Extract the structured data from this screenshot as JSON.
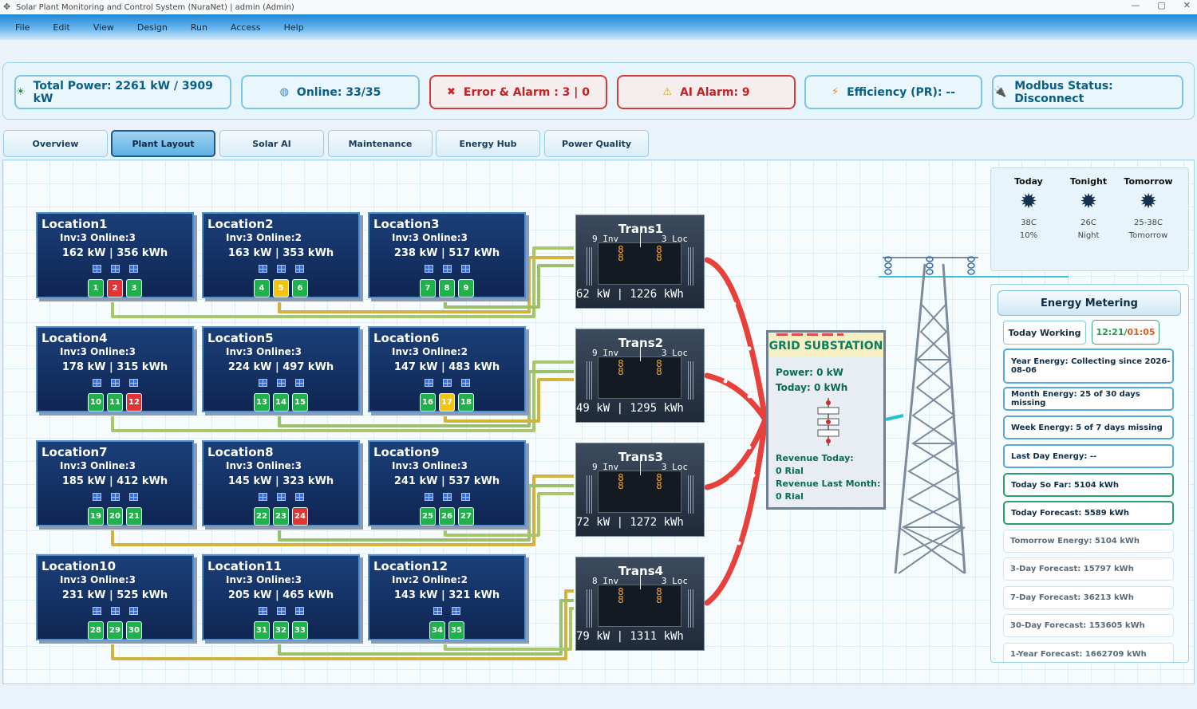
{
  "window": {
    "title": "Solar Plant Monitoring and Control System (NuraNet) | admin (Admin)",
    "minimize": "—",
    "maximize": "▢",
    "close": "✕"
  },
  "menu": [
    "File",
    "Edit",
    "View",
    "Design",
    "Run",
    "Access",
    "Help"
  ],
  "status": {
    "total_power": "Total Power: 2261 kW / 3909 kW",
    "online": "Online: 33/35",
    "error_alarm": "Error & Alarm : 3 | 0",
    "ai_alarm": "AI Alarm: 9",
    "efficiency": "Efficiency (PR): --",
    "modbus": "Modbus Status: Disconnect"
  },
  "tabs": [
    "Overview",
    "Plant Layout",
    "Solar AI",
    "Maintenance",
    "Energy Hub",
    "Power Quality"
  ],
  "active_tab": "Plant Layout",
  "locations": [
    {
      "name": "Location1",
      "inv": "Inv:3  Online:3",
      "power": "162 kW  |  356 kWh",
      "inverters": [
        {
          "n": "1",
          "s": "ok"
        },
        {
          "n": "2",
          "s": "err"
        },
        {
          "n": "3",
          "s": "ok"
        }
      ]
    },
    {
      "name": "Location2",
      "inv": "Inv:3  Online:2",
      "power": "163 kW  |  353 kWh",
      "inverters": [
        {
          "n": "4",
          "s": "ok"
        },
        {
          "n": "5",
          "s": "warn"
        },
        {
          "n": "6",
          "s": "ok"
        }
      ]
    },
    {
      "name": "Location3",
      "inv": "Inv:3  Online:3",
      "power": "238 kW  |  517 kWh",
      "inverters": [
        {
          "n": "7",
          "s": "ok"
        },
        {
          "n": "8",
          "s": "ok"
        },
        {
          "n": "9",
          "s": "ok"
        }
      ]
    },
    {
      "name": "Location4",
      "inv": "Inv:3  Online:3",
      "power": "178 kW  |  315 kWh",
      "inverters": [
        {
          "n": "10",
          "s": "ok"
        },
        {
          "n": "11",
          "s": "ok"
        },
        {
          "n": "12",
          "s": "err"
        }
      ]
    },
    {
      "name": "Location5",
      "inv": "Inv:3  Online:3",
      "power": "224 kW  |  497 kWh",
      "inverters": [
        {
          "n": "13",
          "s": "ok"
        },
        {
          "n": "14",
          "s": "ok"
        },
        {
          "n": "15",
          "s": "ok"
        }
      ]
    },
    {
      "name": "Location6",
      "inv": "Inv:3  Online:2",
      "power": "147 kW  |  483 kWh",
      "inverters": [
        {
          "n": "16",
          "s": "ok"
        },
        {
          "n": "17",
          "s": "warn"
        },
        {
          "n": "18",
          "s": "ok"
        }
      ]
    },
    {
      "name": "Location7",
      "inv": "Inv:3  Online:3",
      "power": "185 kW  |  412 kWh",
      "inverters": [
        {
          "n": "19",
          "s": "ok"
        },
        {
          "n": "20",
          "s": "ok"
        },
        {
          "n": "21",
          "s": "ok"
        }
      ]
    },
    {
      "name": "Location8",
      "inv": "Inv:3  Online:3",
      "power": "145 kW  |  323 kWh",
      "inverters": [
        {
          "n": "22",
          "s": "ok"
        },
        {
          "n": "23",
          "s": "ok"
        },
        {
          "n": "24",
          "s": "err"
        }
      ]
    },
    {
      "name": "Location9",
      "inv": "Inv:3  Online:3",
      "power": "241 kW  |  537 kWh",
      "inverters": [
        {
          "n": "25",
          "s": "ok"
        },
        {
          "n": "26",
          "s": "ok"
        },
        {
          "n": "27",
          "s": "ok"
        }
      ]
    },
    {
      "name": "Location10",
      "inv": "Inv:3  Online:3",
      "power": "231 kW  |  525 kWh",
      "inverters": [
        {
          "n": "28",
          "s": "ok"
        },
        {
          "n": "29",
          "s": "ok"
        },
        {
          "n": "30",
          "s": "ok"
        }
      ]
    },
    {
      "name": "Location11",
      "inv": "Inv:3  Online:3",
      "power": "205 kW  |  465 kWh",
      "inverters": [
        {
          "n": "31",
          "s": "ok"
        },
        {
          "n": "32",
          "s": "ok"
        },
        {
          "n": "33",
          "s": "ok"
        }
      ]
    },
    {
      "name": "Location12",
      "inv": "Inv:2  Online:2",
      "power": "143 kW  |  321 kWh",
      "inverters": [
        {
          "n": "34",
          "s": "ok"
        },
        {
          "n": "35",
          "s": "ok"
        }
      ]
    }
  ],
  "transformers": [
    {
      "name": "Trans1",
      "inv": "9 Inv",
      "loc": "3 Loc",
      "bottom": "62 kW  |  1226 kWh"
    },
    {
      "name": "Trans2",
      "inv": "9 Inv",
      "loc": "3 Loc",
      "bottom": "49 kW  |  1295 kWh"
    },
    {
      "name": "Trans3",
      "inv": "9 Inv",
      "loc": "3 Loc",
      "bottom": "72 kW  |  1272 kWh"
    },
    {
      "name": "Trans4",
      "inv": "8 Inv",
      "loc": "3 Loc",
      "bottom": "79 kW  |  1311 kWh"
    }
  ],
  "substation": {
    "title": "GRID SUBSTATION",
    "power": "Power: 0 kW",
    "today": "Today: 0 kWh",
    "rev_today_label": "Revenue Today:",
    "rev_today": "0 Rial",
    "rev_month_label": "Revenue Last Month:",
    "rev_month": "0 Rial"
  },
  "weather": [
    {
      "head": "Today",
      "line1": "38C",
      "line2": "10%"
    },
    {
      "head": "Tonight",
      "line1": "26C",
      "line2": "Night"
    },
    {
      "head": "Tomorrow",
      "line1": "25-38C",
      "line2": "Tomorrow"
    }
  ],
  "metering": {
    "title": "Energy Metering",
    "today_working": "Today Working",
    "time_start": "12:21",
    "time_sep": "/",
    "time_end": "01:05",
    "rows": [
      {
        "text": "Year Energy: Collecting since 2026-08-06",
        "style": "blue"
      },
      {
        "text": "Month Energy: 25 of 30 days missing",
        "style": "blue"
      },
      {
        "text": "Week Energy: 5 of 7 days missing",
        "style": "blue"
      },
      {
        "text": "Last Day Energy: --",
        "style": "blue"
      },
      {
        "text": "Today So Far: 5104 kWh",
        "style": "green"
      },
      {
        "text": "Today Forecast: 5589 kWh",
        "style": "green"
      },
      {
        "text": "Tomorrow Energy: 5104 kWh",
        "style": "faded"
      },
      {
        "text": "3-Day Forecast: 15797 kWh",
        "style": "faded"
      },
      {
        "text": "7-Day Forecast: 36213 kWh",
        "style": "faded"
      },
      {
        "text": "30-Day Forecast: 153605 kWh",
        "style": "faded"
      },
      {
        "text": "1-Year Forecast: 1662709 kWh",
        "style": "faded"
      }
    ]
  },
  "colors": {
    "accent": "#1f86d6",
    "ok": "#1fb14a",
    "error": "#e23434",
    "warning": "#f4c415",
    "line_hot": "#e8403a"
  }
}
